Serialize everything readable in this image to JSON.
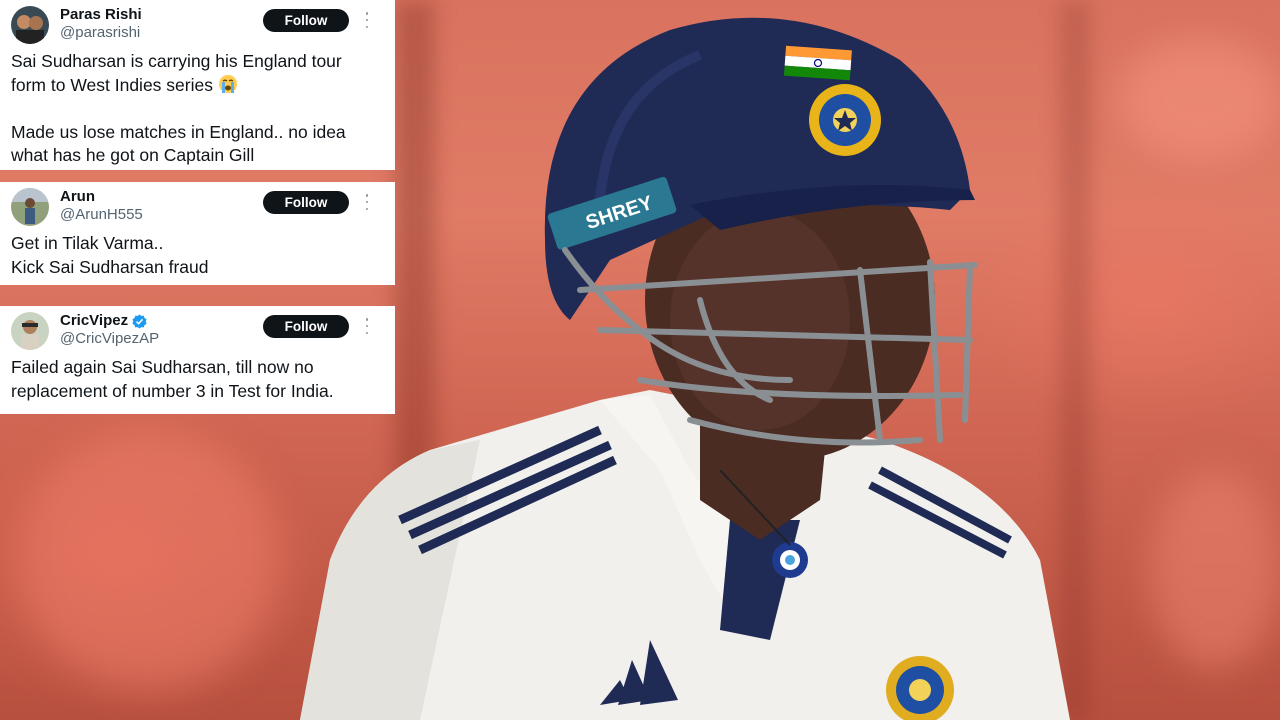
{
  "tweets": [
    {
      "name": "Paras Rishi",
      "handle": "@parasrishi",
      "follow_label": "Follow",
      "verified": false,
      "text_lines": [
        "Sai Sudharsan is carrying his England tour",
        "form to West Indies series",
        "",
        "Made us lose matches in England.. no idea",
        "what has he got on Captain Gill"
      ],
      "emoji": "loudly-crying-face-emoji"
    },
    {
      "name": "Arun",
      "handle": "@ArunH555",
      "follow_label": "Follow",
      "verified": false,
      "text_lines": [
        "Get in Tilak Varma..",
        "Kick Sai Sudharsan fraud"
      ]
    },
    {
      "name": "CricVipez",
      "handle": "@CricVipezAP",
      "follow_label": "Follow",
      "verified": true,
      "text_lines": [
        "Failed again Sai Sudharsan, till now no",
        "replacement of number 3 in Test for India."
      ]
    }
  ],
  "photo": {
    "helmet_text": "SHREY",
    "colors": {
      "helmet": "#1f2a55",
      "jersey": "#f1f0ec",
      "background": "#d9735f",
      "follow_button": "#0f1419",
      "verified": "#1d9bf0"
    }
  }
}
